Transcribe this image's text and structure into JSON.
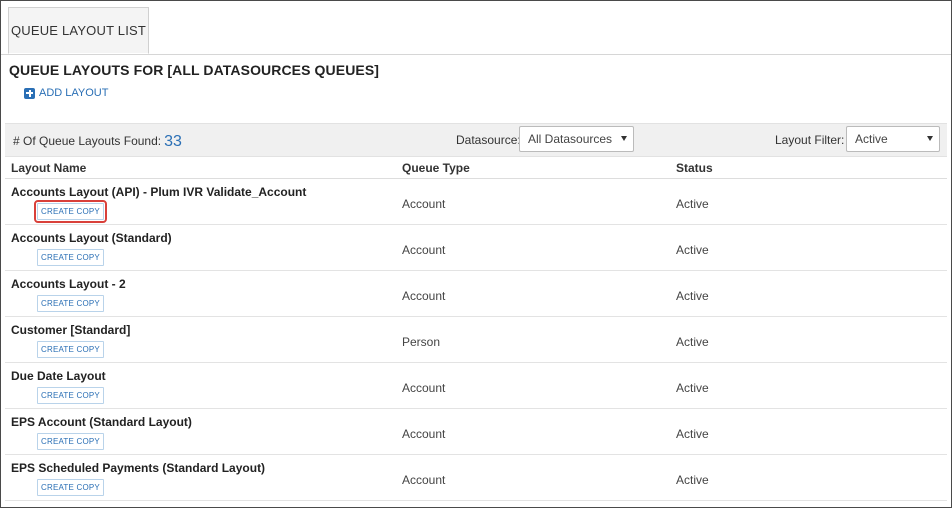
{
  "tab": {
    "label": "QUEUE LAYOUT LIST"
  },
  "page": {
    "title": "QUEUE LAYOUTS FOR [ALL DATASOURCES QUEUES]"
  },
  "add_layout": {
    "label": "ADD LAYOUT"
  },
  "filterbar": {
    "found_label": "# Of Queue Layouts Found:",
    "found_count": "33",
    "datasource_label": "Datasource:",
    "datasource_value": "All Datasources",
    "layout_filter_label": "Layout Filter:",
    "layout_filter_value": "Active"
  },
  "table": {
    "columns": [
      "Layout Name",
      "Queue Type",
      "Status"
    ],
    "copy_label": "CREATE COPY",
    "rows": [
      {
        "name": "Accounts Layout (API) - Plum IVR Validate_Account",
        "type": "Account",
        "status": "Active"
      },
      {
        "name": "Accounts Layout (Standard)",
        "type": "Account",
        "status": "Active"
      },
      {
        "name": "Accounts Layout - 2",
        "type": "Account",
        "status": "Active"
      },
      {
        "name": "Customer [Standard]",
        "type": "Person",
        "status": "Active"
      },
      {
        "name": "Due Date Layout",
        "type": "Account",
        "status": "Active"
      },
      {
        "name": "EPS Account (Standard Layout)",
        "type": "Account",
        "status": "Active"
      },
      {
        "name": "EPS Scheduled Payments (Standard Layout)",
        "type": "Account",
        "status": "Active"
      }
    ]
  },
  "colors": {
    "accent": "#2a6fb5",
    "highlight": "#d9403a"
  }
}
